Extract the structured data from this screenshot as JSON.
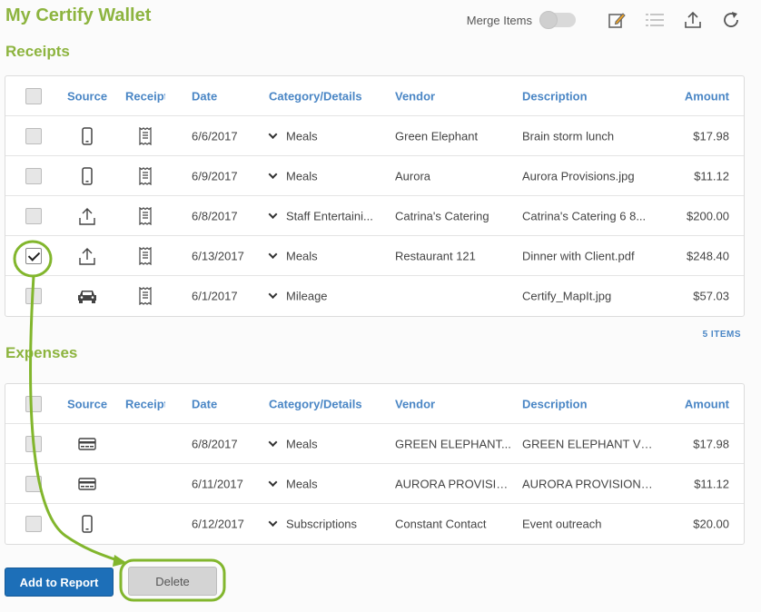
{
  "app": {
    "title": "My Certify Wallet"
  },
  "toolbar": {
    "merge_label": "Merge Items",
    "merge_on": false
  },
  "receipts": {
    "title": "Receipts",
    "headers": {
      "source": "Source",
      "receipt": "Receipt",
      "date": "Date",
      "category": "Category/Details",
      "vendor": "Vendor",
      "description": "Description",
      "amount": "Amount"
    },
    "rows": [
      {
        "checked": false,
        "source_icon": "mobile-icon",
        "date": "6/6/2017",
        "category": "Meals",
        "vendor": "Green Elephant",
        "description": "Brain storm lunch",
        "amount": "$17.98"
      },
      {
        "checked": false,
        "source_icon": "mobile-icon",
        "date": "6/9/2017",
        "category": "Meals",
        "vendor": "Aurora",
        "description": "Aurora Provisions.jpg",
        "amount": "$11.12"
      },
      {
        "checked": false,
        "source_icon": "upload-icon",
        "date": "6/8/2017",
        "category": "Staff Entertaini...",
        "vendor": "Catrina's Catering",
        "description": "Catrina's Catering 6 8...",
        "amount": "$200.00"
      },
      {
        "checked": true,
        "source_icon": "upload-icon",
        "date": "6/13/2017",
        "category": "Meals",
        "vendor": "Restaurant 121",
        "description": "Dinner with Client.pdf",
        "amount": "$248.40"
      },
      {
        "checked": false,
        "source_icon": "car-icon",
        "date": "6/1/2017",
        "category": "Mileage",
        "vendor": "",
        "description": "Certify_MapIt.jpg",
        "amount": "$57.03"
      }
    ],
    "count_label": "5 ITEMS"
  },
  "expenses": {
    "title": "Expenses",
    "headers": {
      "source": "Source",
      "receipt": "Receipt",
      "date": "Date",
      "category": "Category/Details",
      "vendor": "Vendor",
      "description": "Description",
      "amount": "Amount"
    },
    "rows": [
      {
        "checked": false,
        "source_icon": "credit-card-icon",
        "date": "6/8/2017",
        "category": "Meals",
        "vendor": "GREEN ELEPHANT...",
        "description": "GREEN ELEPHANT VE...",
        "amount": "$17.98"
      },
      {
        "checked": false,
        "source_icon": "credit-card-icon",
        "date": "6/11/2017",
        "category": "Meals",
        "vendor": "AURORA PROVISIO...",
        "description": "AURORA PROVISIONS..",
        "amount": "$11.12"
      },
      {
        "checked": false,
        "source_icon": "mobile-icon",
        "date": "6/12/2017",
        "category": "Subscriptions",
        "vendor": "Constant Contact",
        "description": "Event outreach",
        "amount": "$20.00"
      }
    ]
  },
  "actions": {
    "add_to_report": "Add to Report",
    "delete": "Delete"
  },
  "colors": {
    "brand_green": "#8db43f",
    "link_blue": "#4a86c5",
    "primary_button": "#1d6fb8",
    "annotation": "#82b62d"
  }
}
